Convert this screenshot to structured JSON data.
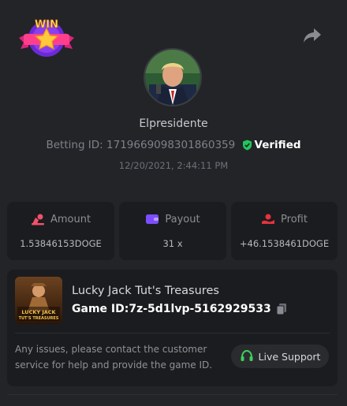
{
  "badge": {
    "text": "WIN",
    "icon": "win-badge-icon"
  },
  "share": {
    "icon": "share-icon"
  },
  "profile": {
    "username": "Elpresidente",
    "betting_id_label": "Betting ID:",
    "betting_id": "1719669098301860359",
    "verified_label": "Verified",
    "timestamp": "12/20/2021, 2:44:11 PM"
  },
  "stats": {
    "amount": {
      "label": "Amount",
      "value": "1.53846153DOGE",
      "icon": "amount-icon"
    },
    "payout": {
      "label": "Payout",
      "value": "31 x",
      "icon": "wallet-icon"
    },
    "profit": {
      "label": "Profit",
      "value": "+46.1538461DOGE",
      "icon": "profit-icon"
    }
  },
  "game": {
    "name": "Lucky Jack Tut's Treasures",
    "id_label": "Game ID:",
    "id": "7z-5d1lvp-5162929533",
    "thumb_text": "LUCKY JACK TUT'S TREASURES"
  },
  "support": {
    "help_text": "Any issues, please contact the customer service for help and provide the game ID.",
    "button_label": "Live Support"
  },
  "colors": {
    "background": "#232428",
    "card": "#1b1c1f",
    "verified_green": "#22c55e",
    "amount_icon": "#f0516a",
    "payout_icon": "#7c4dff",
    "profit_icon": "#e8323d",
    "support_icon": "#3ecf5a"
  }
}
